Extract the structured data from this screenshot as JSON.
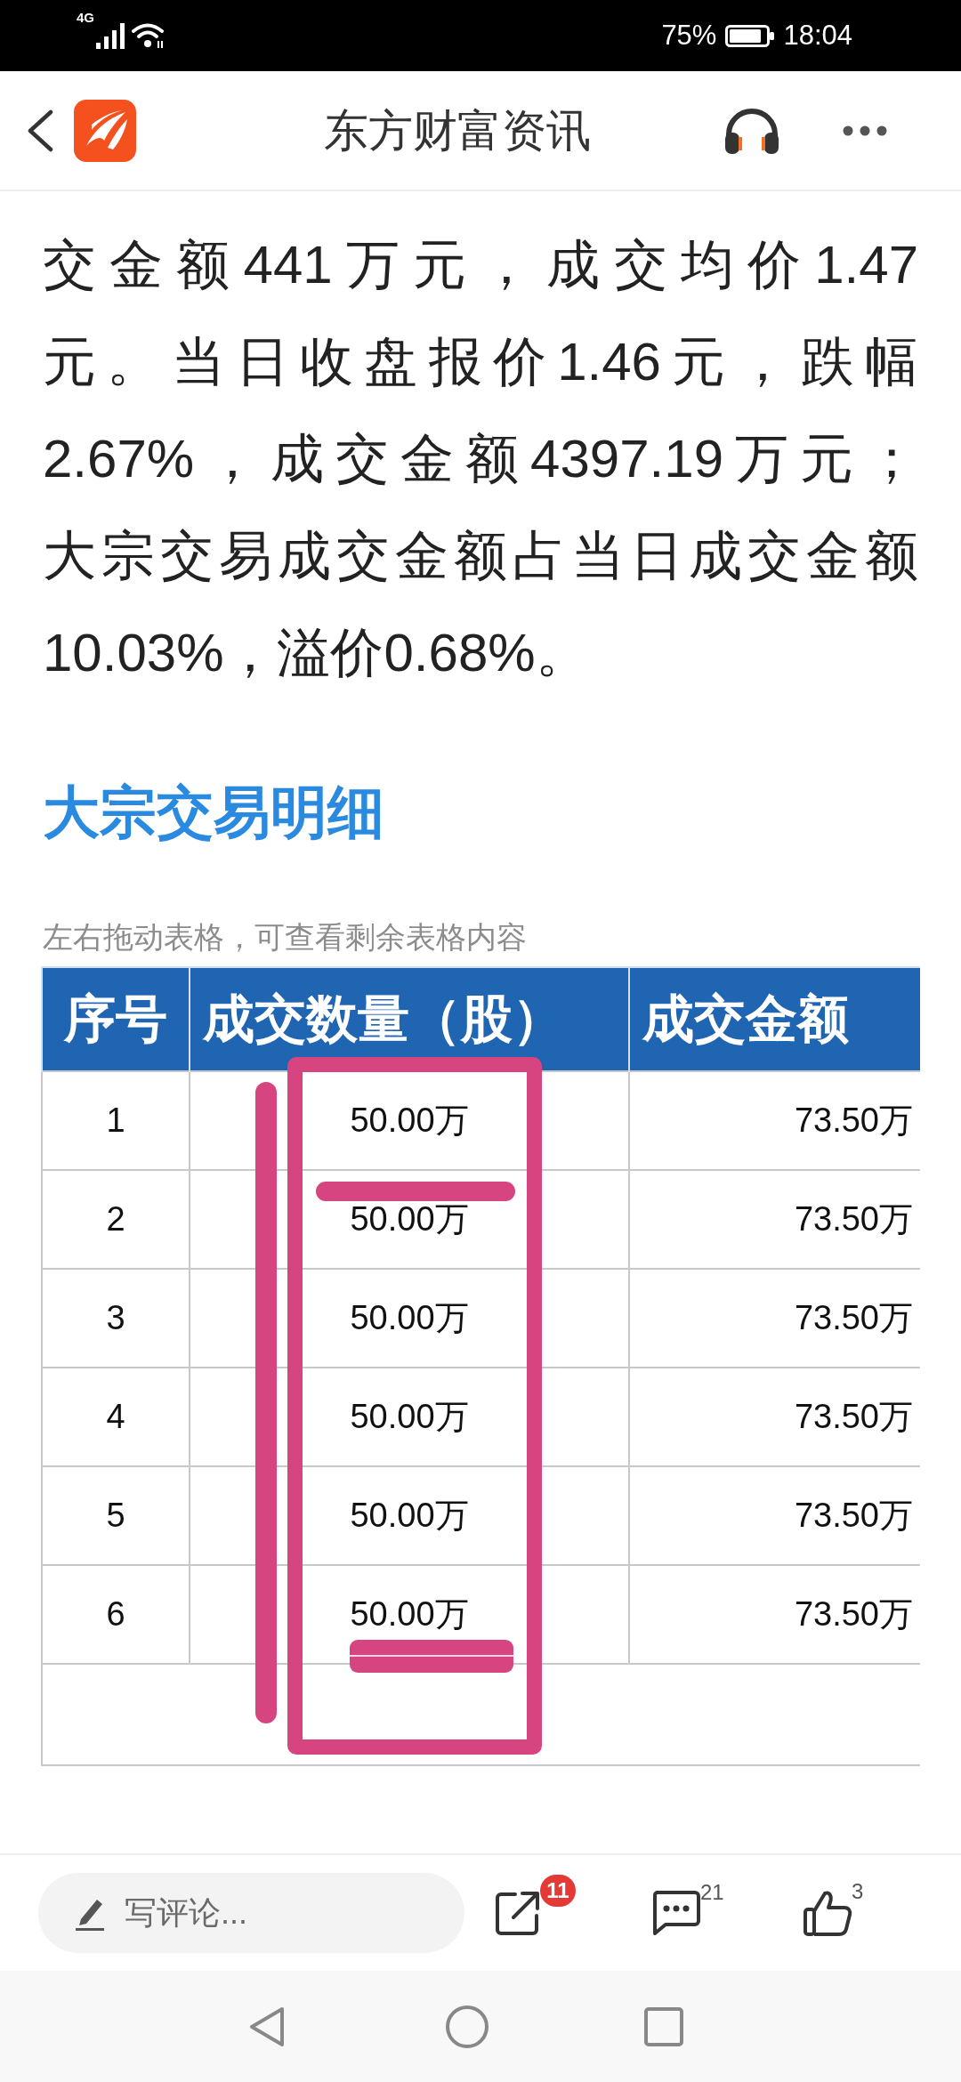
{
  "status_bar": {
    "network": "4G",
    "battery": "75%",
    "time": "18:04"
  },
  "header": {
    "title": "东方财富资讯"
  },
  "article": {
    "paragraph_lines": [
      "交金额441万元，成交均价1.47",
      "元。当日收盘报价1.46元，跌幅",
      "2.67%，成交金额4397.19万元；",
      "大宗交易成交金额占当日成交金额",
      "10.03%，溢价0.68%。"
    ],
    "section_title": "大宗交易明细",
    "table_hint": "左右拖动表格，可查看剩余表格内容",
    "table": {
      "columns": [
        "序号",
        "成交数量（股）",
        "成交金额"
      ],
      "rows": [
        [
          "1",
          "50.00万",
          "73.50万"
        ],
        [
          "2",
          "50.00万",
          "73.50万"
        ],
        [
          "3",
          "50.00万",
          "73.50万"
        ],
        [
          "4",
          "50.00万",
          "73.50万"
        ],
        [
          "5",
          "50.00万",
          "73.50万"
        ],
        [
          "6",
          "50.00万",
          "73.50万"
        ]
      ]
    }
  },
  "bottom_bar": {
    "comment": {
      "placeholder": "写评论..."
    },
    "share_badge": "11",
    "comment_count": "21",
    "like_count": "3"
  }
}
